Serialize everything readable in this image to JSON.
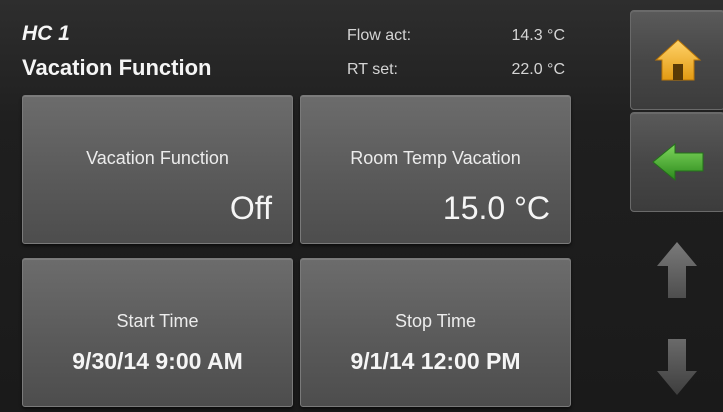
{
  "header": {
    "circuit": "HC 1",
    "title": "Vacation Function",
    "status": [
      {
        "label": "Flow act:",
        "value": "14.3 °C"
      },
      {
        "label": "RT set:",
        "value": "22.0 °C"
      }
    ]
  },
  "tiles": [
    {
      "label": "Vacation Function",
      "value": "Off"
    },
    {
      "label": "Room Temp Vacation",
      "value": "15.0 °C"
    },
    {
      "label": "Start Time",
      "value": "9/30/14 9:00 AM"
    },
    {
      "label": "Stop Time",
      "value": "9/1/14 12:00 PM"
    }
  ],
  "sidebar": {
    "home_icon": "home-icon",
    "back_icon": "back-arrow-icon",
    "up_icon": "scroll-up-icon",
    "down_icon": "scroll-down-icon",
    "home_color": "#f2b32a",
    "back_color": "#3ea52c",
    "disabled_arrow_color": "#6a6a6a"
  }
}
